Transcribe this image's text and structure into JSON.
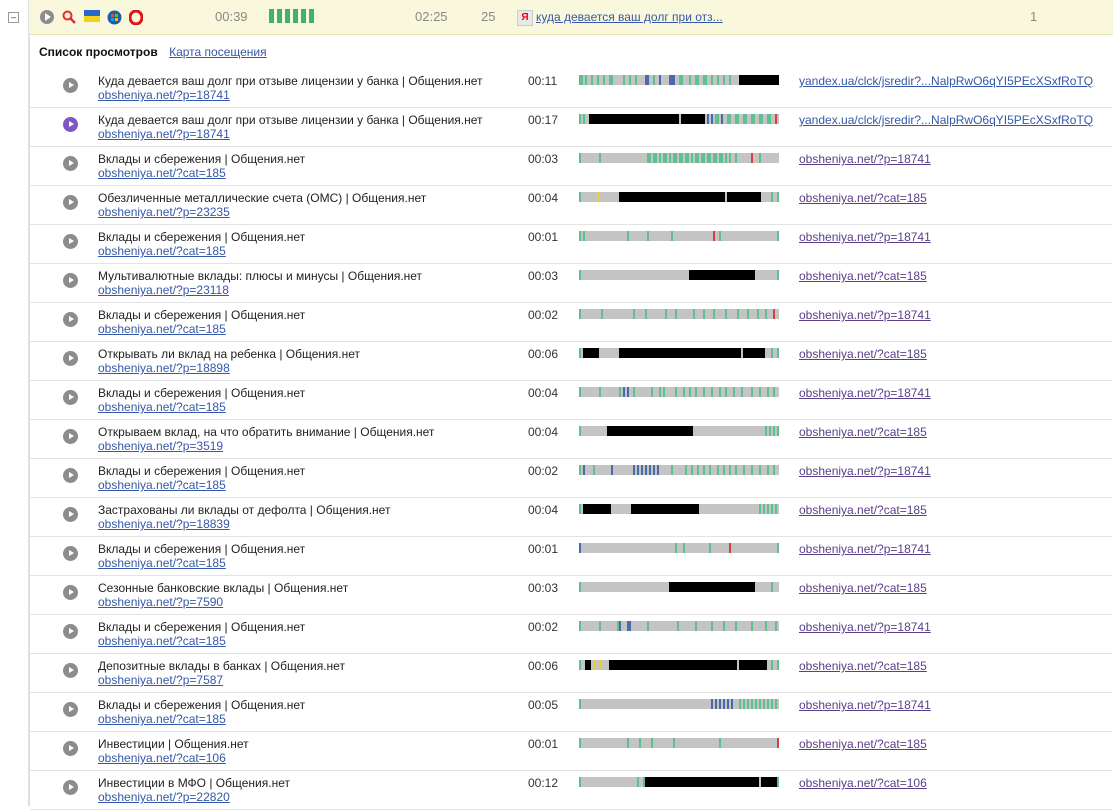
{
  "topbar": {
    "collapse_label": "–",
    "icons": [
      "play-icon",
      "search-icon",
      "flag-ua-icon",
      "windows7-icon",
      "opera-icon"
    ],
    "time_on_site": "00:39",
    "visit_time": "02:25",
    "depth": "25",
    "referrer_link": "куда девается ваш долг при отз...",
    "visits_count": "1",
    "activity_bar_fraction": 0.6
  },
  "tabs": {
    "active": "Список просмотров",
    "link": "Карта посещения"
  },
  "colors": {
    "gray": "#c4c4c4",
    "black": "#000000",
    "green": "#5fbf8f",
    "blue": "#4a6aa8",
    "red": "#d64040",
    "yellow": "#e8d23a",
    "accent_play": "#7e57c2"
  },
  "rows": [
    {
      "title": "Куда девается ваш долг при отзыве лицензии у банка | Общения.нет",
      "url": "obsheniya.net/?p=18741",
      "duration": "00:11",
      "referrer": "yandex.ua/clck/jsredir?...NalpRwO6qYI5PEcXSxfRoTQ",
      "active": false
    },
    {
      "title": "Куда девается ваш долг при отзыве лицензии у банка | Общения.нет",
      "url": "obsheniya.net/?p=18741",
      "duration": "00:17",
      "referrer": "yandex.ua/clck/jsredir?...NalpRwO6qYI5PEcXSxfRoTQ",
      "active": true
    },
    {
      "title": "Вклады и сбережения | Общения.нет",
      "url": "obsheniya.net/?cat=185",
      "duration": "00:03",
      "referrer": "obsheniya.net/?p=18741",
      "active": false
    },
    {
      "title": "Обезличенные металлические счета (ОМС) | Общения.нет",
      "url": "obsheniya.net/?p=23235",
      "duration": "00:04",
      "referrer": "obsheniya.net/?cat=185",
      "active": false
    },
    {
      "title": "Вклады и сбережения | Общения.нет",
      "url": "obsheniya.net/?cat=185",
      "duration": "00:01",
      "referrer": "obsheniya.net/?p=18741",
      "active": false
    },
    {
      "title": "Мультивалютные вклады: плюсы и минусы | Общения.нет",
      "url": "obsheniya.net/?p=23118",
      "duration": "00:03",
      "referrer": "obsheniya.net/?cat=185",
      "active": false
    },
    {
      "title": "Вклады и сбережения | Общения.нет",
      "url": "obsheniya.net/?cat=185",
      "duration": "00:02",
      "referrer": "obsheniya.net/?p=18741",
      "active": false
    },
    {
      "title": "Открывать ли вклад на ребенка | Общения.нет",
      "url": "obsheniya.net/?p=18898",
      "duration": "00:06",
      "referrer": "obsheniya.net/?cat=185",
      "active": false
    },
    {
      "title": "Вклады и сбережения | Общения.нет",
      "url": "obsheniya.net/?cat=185",
      "duration": "00:04",
      "referrer": "obsheniya.net/?p=18741",
      "active": false
    },
    {
      "title": "Открываем вклад, на что обратить внимание | Общения.нет",
      "url": "obsheniya.net/?p=3519",
      "duration": "00:04",
      "referrer": "obsheniya.net/?cat=185",
      "active": false
    },
    {
      "title": "Вклады и сбережения | Общения.нет",
      "url": "obsheniya.net/?cat=185",
      "duration": "00:02",
      "referrer": "obsheniya.net/?p=18741",
      "active": false
    },
    {
      "title": "Застрахованы ли вклады от дефолта | Общения.нет",
      "url": "obsheniya.net/?p=18839",
      "duration": "00:04",
      "referrer": "obsheniya.net/?cat=185",
      "active": false
    },
    {
      "title": "Вклады и сбережения | Общения.нет",
      "url": "obsheniya.net/?cat=185",
      "duration": "00:01",
      "referrer": "obsheniya.net/?p=18741",
      "active": false
    },
    {
      "title": "Сезонные банковские вклады | Общения.нет",
      "url": "obsheniya.net/?p=7590",
      "duration": "00:03",
      "referrer": "obsheniya.net/?cat=185",
      "active": false
    },
    {
      "title": "Вклады и сбережения | Общения.нет",
      "url": "obsheniya.net/?cat=185",
      "duration": "00:02",
      "referrer": "obsheniya.net/?p=18741",
      "active": false
    },
    {
      "title": "Депозитные вклады в банках | Общения.нет",
      "url": "obsheniya.net/?p=7587",
      "duration": "00:06",
      "referrer": "obsheniya.net/?cat=185",
      "active": false
    },
    {
      "title": "Вклады и сбережения | Общения.нет",
      "url": "obsheniya.net/?cat=185",
      "duration": "00:05",
      "referrer": "obsheniya.net/?p=18741",
      "active": false
    },
    {
      "title": "Инвестиции | Общения.нет",
      "url": "obsheniya.net/?cat=106",
      "duration": "00:01",
      "referrer": "obsheniya.net/?cat=185",
      "active": false
    },
    {
      "title": "Инвестиции в МФО | Общения.нет",
      "url": "obsheniya.net/?p=22820",
      "duration": "00:12",
      "referrer": "obsheniya.net/?cat=106",
      "active": false
    }
  ]
}
